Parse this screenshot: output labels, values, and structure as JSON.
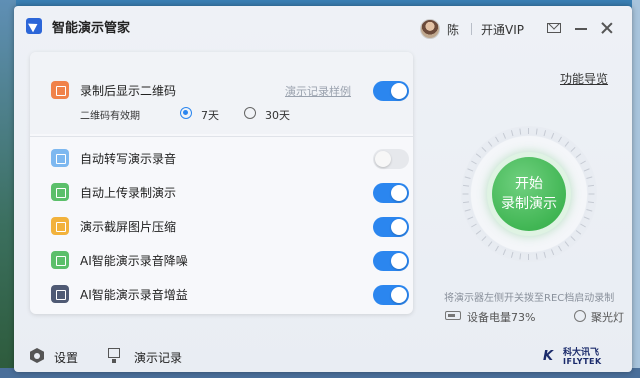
{
  "window": {
    "title": "智能演示管家",
    "user_name": "陈",
    "vip_label": "开通VIP"
  },
  "settings": {
    "qr": {
      "label": "录制后显示二维码",
      "sample_link": "演示记录样例",
      "enabled": true,
      "validity_label": "二维码有效期",
      "options": [
        {
          "label": "7天",
          "selected": true
        },
        {
          "label": "30天",
          "selected": false
        }
      ]
    },
    "items": [
      {
        "label": "自动转写演示录音",
        "enabled": false,
        "icon": "transcribe-icon",
        "color": "#7db8f0"
      },
      {
        "label": "自动上传录制演示",
        "enabled": true,
        "icon": "upload-icon",
        "color": "#5bbf6a"
      },
      {
        "label": "演示截屏图片压缩",
        "enabled": true,
        "icon": "image-compress-icon",
        "color": "#f2b23c"
      },
      {
        "label": "AI智能演示录音降噪",
        "enabled": true,
        "icon": "noise-reduction-icon",
        "color": "#5bbf6a"
      },
      {
        "label": "AI智能演示录音增益",
        "enabled": true,
        "icon": "gain-icon",
        "color": "#4f5a74"
      }
    ]
  },
  "record": {
    "func_guide": "功能导览",
    "button_line1": "开始",
    "button_line2": "录制演示",
    "hint": "将演示器左侧开关拨至REC档启动录制",
    "battery": "设备电量73%",
    "spotlight": "聚光灯"
  },
  "bottom": {
    "settings": "设置",
    "records": "演示记录",
    "brand_cn": "科大讯飞",
    "brand_en": "IFLYTEK"
  },
  "colors": {
    "accent": "#2b86ef",
    "record_green": "#41b654",
    "qr_icon": "#f0824a"
  }
}
